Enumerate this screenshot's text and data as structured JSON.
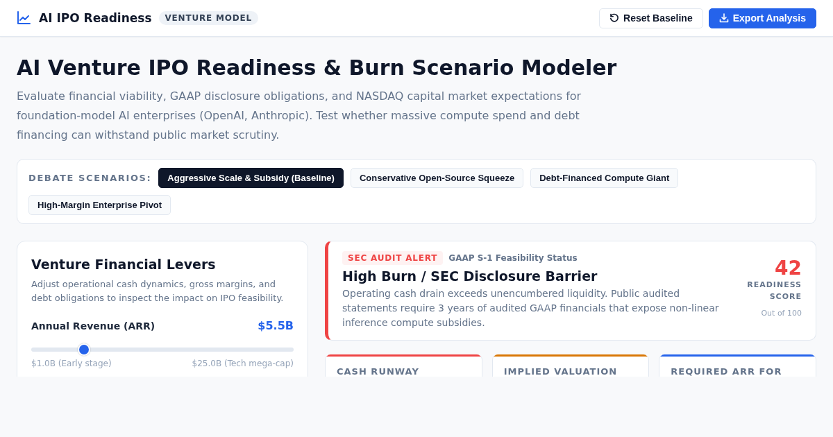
{
  "header": {
    "title": "AI IPO Readiness",
    "badge": "VENTURE MODEL",
    "buttons": [
      {
        "label": "Reset Baseline",
        "kind": "secondary"
      },
      {
        "label": "Export Analysis",
        "kind": "primary"
      }
    ]
  },
  "page": {
    "title": "AI Venture IPO Readiness & Burn Scenario Modeler",
    "description": "Evaluate financial viability, GAAP disclosure obligations, and NASDAQ capital market expectations for foundation-model AI enterprises (OpenAI, Anthropic). Test whether massive compute spend and debt financing can withstand public market scrutiny."
  },
  "scenarios": {
    "label": "DEBATE SCENARIOS:",
    "items": [
      {
        "label": "Aggressive Scale & Subsidy (Baseline)",
        "selected": true
      },
      {
        "label": "Conservative Open-Source Squeeze",
        "selected": false
      },
      {
        "label": "Debt-Financed Compute Giant",
        "selected": false
      },
      {
        "label": "High-Margin Enterprise Pivot",
        "selected": false
      }
    ]
  },
  "levers": {
    "title": "Venture Financial Levers",
    "description": "Adjust operational cash dynamics, gross margins, and debt obligations to inspect the impact on IPO feasibility.",
    "sliders": [
      {
        "label": "Annual Revenue (ARR)",
        "reading": "$5.5B",
        "level": 0.2,
        "min_label": "$1.0B (Early stage)",
        "max_label": "$25.0B (Tech mega-cap)"
      }
    ]
  },
  "status": {
    "tag": "SEC AUDIT ALERT",
    "subtitle": "GAAP S-1 Feasibility Status",
    "title": "High Burn / SEC Disclosure Barrier",
    "description": "Operating cash drain exceeds unencumbered liquidity. Public audited statements require 3 years of audited GAAP financials that expose non-linear inference compute subsidies.",
    "score": "42",
    "score_label": "READINESS SCORE",
    "score_caption": "Out of 100"
  },
  "metrics": [
    {
      "label": "CASH RUNWAY",
      "color": "#ef4444"
    },
    {
      "label": "IMPLIED VALUATION",
      "color": "#d97706"
    },
    {
      "label": "REQUIRED ARR FOR",
      "color": "#2563eb"
    }
  ]
}
